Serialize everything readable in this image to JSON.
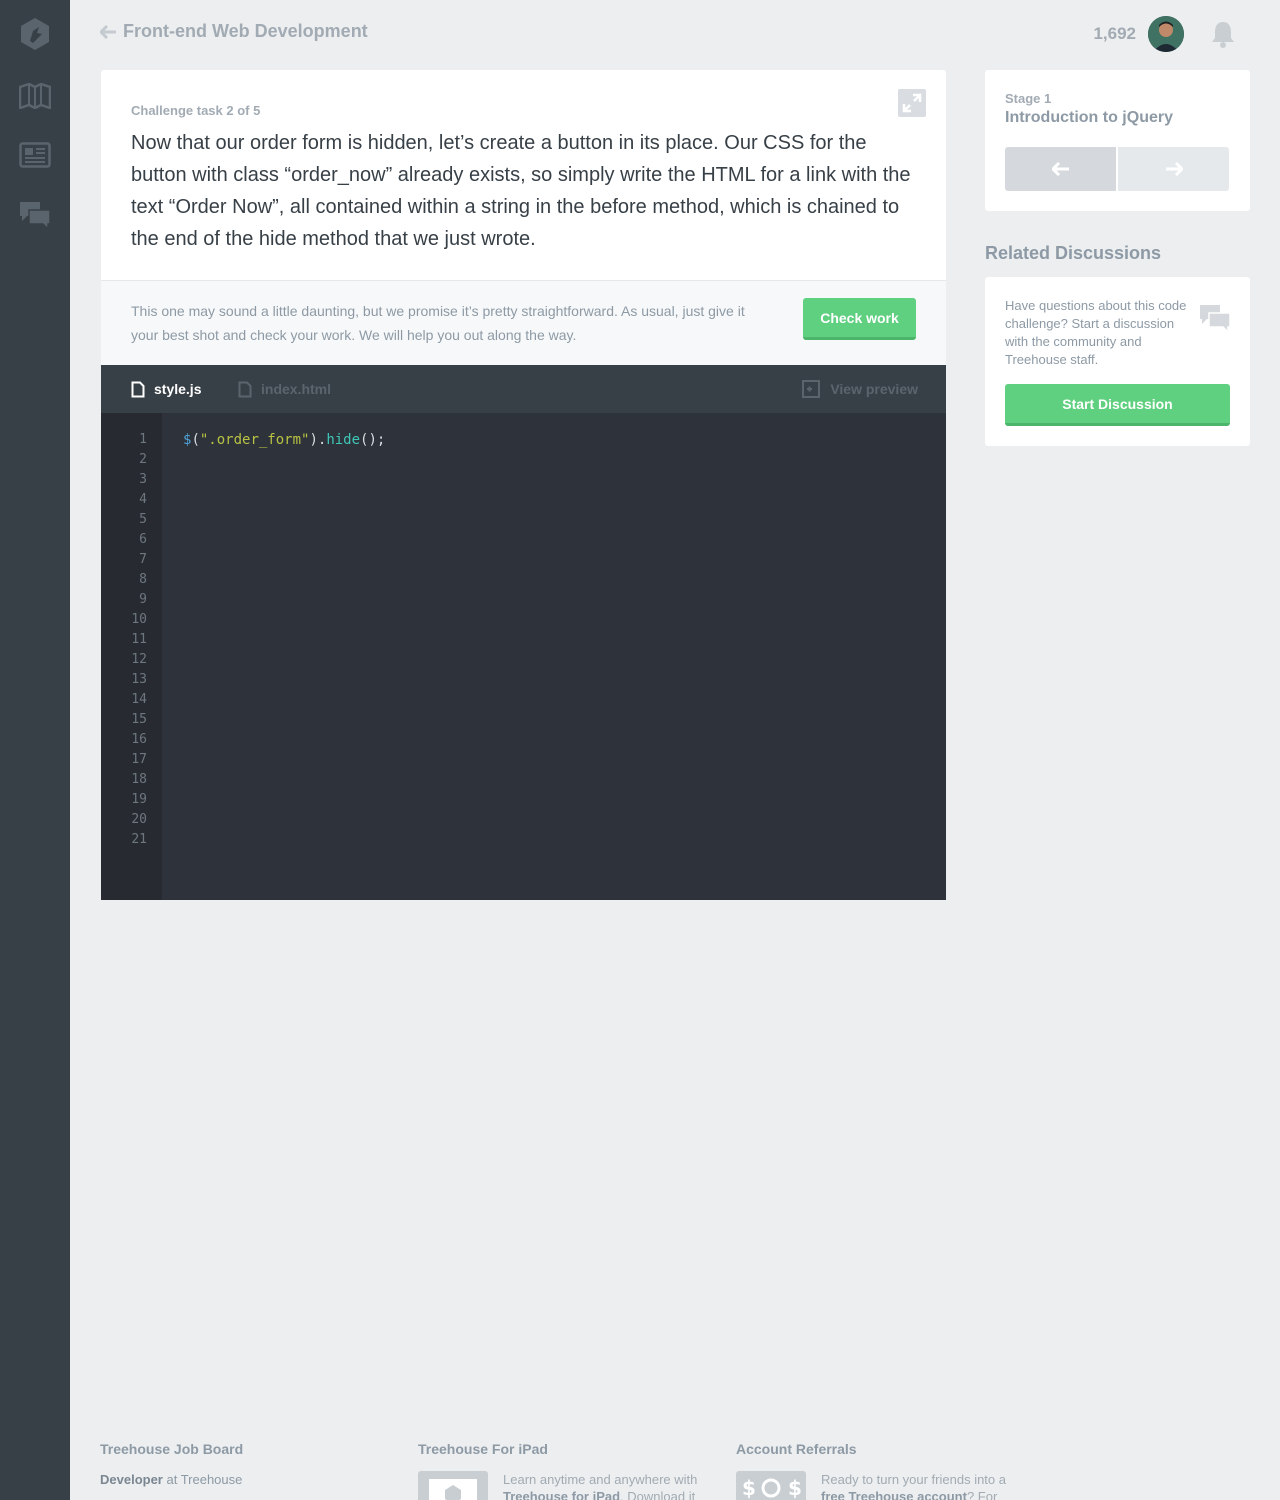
{
  "topbar": {
    "back_label": "Front-end Web Development",
    "points": "1,692"
  },
  "challenge": {
    "task_label": "Challenge task 2 of 5",
    "question": "Now that our order form is hidden, let’s create a button in its place. Our CSS for the button with class “order_now” already exists, so simply write the HTML for a link with the text “Order Now”, all contained within a string in the before method, which is chained to the end of the hide method that we just wrote.",
    "hint": "This one may sound a little daunting, but we promise it’s pretty straightforward. As usual, just give it your best shot and check your work. We will help you out along the way.",
    "check_label": "Check work"
  },
  "editor": {
    "tabs": [
      {
        "label": "style.js",
        "active": true
      },
      {
        "label": "index.html",
        "active": false
      }
    ],
    "preview_label": "View preview",
    "line_numbers": [
      "1",
      "2",
      "3",
      "4",
      "5",
      "6",
      "7",
      "8",
      "9",
      "10",
      "11",
      "12",
      "13",
      "14",
      "15",
      "16",
      "17",
      "18",
      "19",
      "20",
      "21"
    ],
    "code": {
      "dollar": "$",
      "paren_open": "(",
      "string": "\".order_form\"",
      "dot_close": ").",
      "method": "hide",
      "tail": "();"
    }
  },
  "stage": {
    "label": "Stage 1",
    "title": "Introduction to jQuery"
  },
  "related": {
    "title": "Related Discussions",
    "text": "Have questions about this code challenge? Start a discussion with the community and Treehouse staff.",
    "button_label": "Start Discussion"
  },
  "footer": {
    "job_board": {
      "title": "Treehouse Job Board",
      "role": "Developer",
      "at": " at Treehouse"
    },
    "ipad": {
      "title": "Treehouse For iPad",
      "text_pre": "Learn anytime and anywhere with ",
      "text_bold": "Treehouse for iPad",
      "text_post": ". Download it"
    },
    "referrals": {
      "title": "Account Referrals",
      "text_pre": "Ready to turn your friends into a ",
      "text_bold": "free Treehouse account",
      "text_post": "? For"
    }
  },
  "colors": {
    "sidebar": "#384047",
    "accent_green": "#5fcf80",
    "editor_bg": "#2e323a",
    "page_bg": "#eceef0"
  },
  "icons": [
    "treehouse-logo-icon",
    "map-icon",
    "news-icon",
    "chat-icon",
    "back-arrow-icon",
    "bell-icon",
    "expand-icon",
    "file-icon",
    "preview-icon",
    "arrow-left-icon",
    "arrow-right-icon",
    "discussion-icon"
  ]
}
